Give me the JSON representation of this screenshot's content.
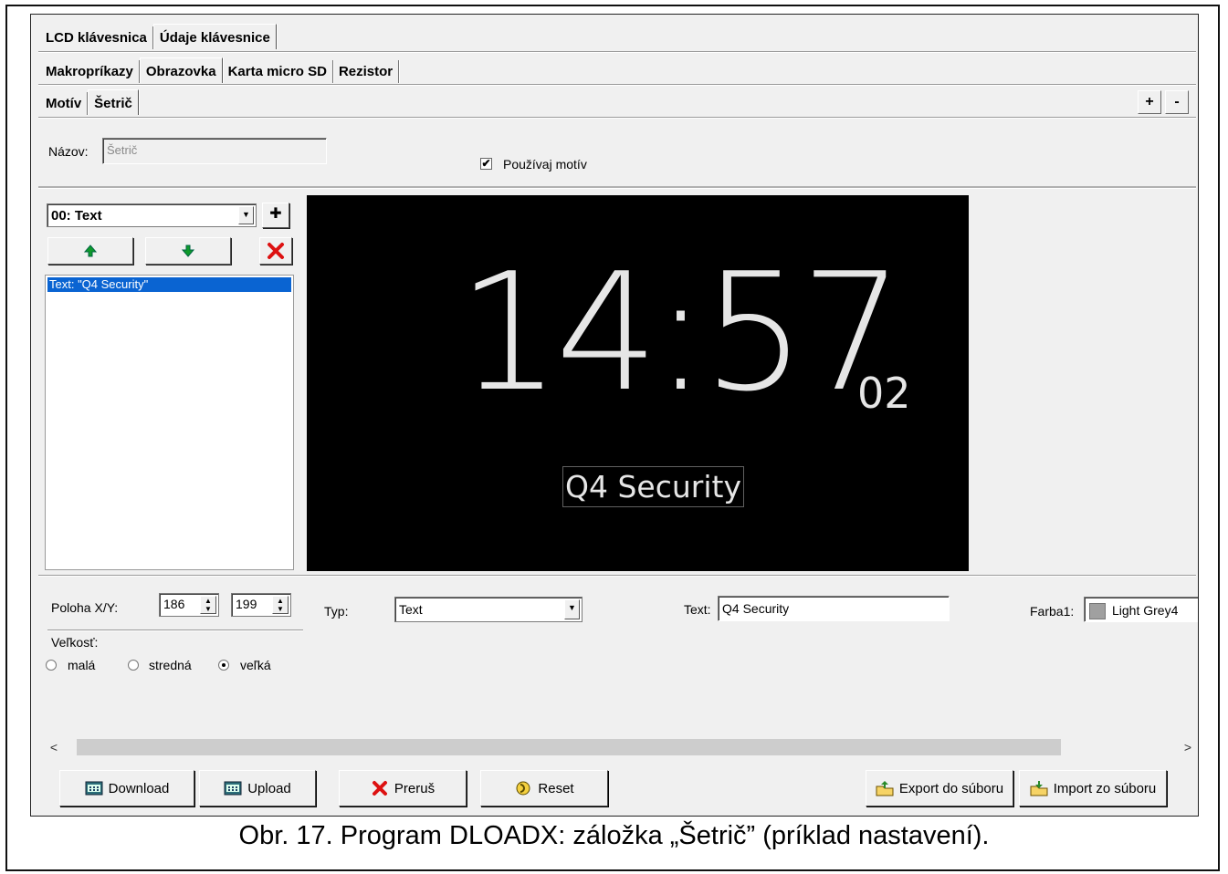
{
  "tabs_top": [
    "LCD klávesnica",
    "Údaje klávesnice"
  ],
  "tabs_second": [
    "Makropríkazy",
    "Obrazovka",
    "Karta micro SD",
    "Rezistor"
  ],
  "tabs_third": [
    "Motív",
    "Šetrič"
  ],
  "plus_label": "+",
  "minus_label": "-",
  "name_label": "Názov:",
  "name_value": "Šetrič",
  "use_theme_label": "Používaj motív",
  "use_theme_checked": true,
  "element_select": "00: Text",
  "list_items": [
    "Text: \"Q4 Security\""
  ],
  "preview": {
    "clock": "14:57",
    "seconds": "02",
    "text": "Q4 Security"
  },
  "position_label": "Poloha X/Y:",
  "pos_x": "186",
  "pos_y": "199",
  "type_label": "Typ:",
  "type_value": "Text",
  "text_label": "Text:",
  "text_value": "Q4 Security",
  "color_label": "Farba1:",
  "color_value": "Light Grey4",
  "color_swatch": "#a0a0a0",
  "size_label": "Veľkosť:",
  "size_options": [
    "malá",
    "stredná",
    "veľká"
  ],
  "size_selected": "veľká",
  "buttons": {
    "download": "Download",
    "upload": "Upload",
    "abort": "Preruš",
    "reset": "Reset",
    "export": "Export do súboru",
    "import": "Import zo súboru"
  },
  "caption": "Obr. 17. Program DLOADX: záložka „Šetrič” (príklad nastavení)."
}
